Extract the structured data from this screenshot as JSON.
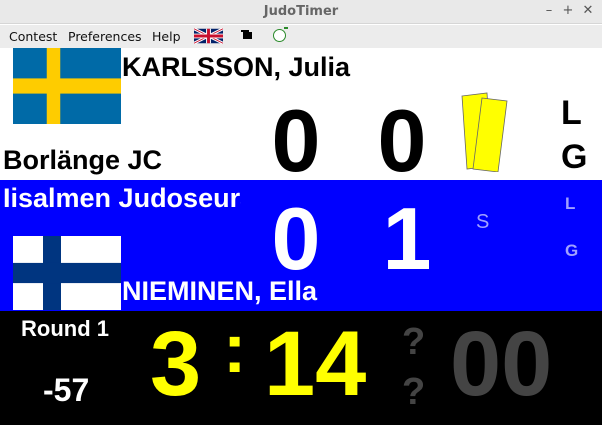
{
  "window": {
    "title": "JudoTimer",
    "min_glyph": "–",
    "max_glyph": "+",
    "close_glyph": "✕"
  },
  "menu": {
    "items": [
      "Contest",
      "Preferences",
      "Help"
    ],
    "icons": [
      "uk-flag-icon",
      "black-rectangle-icon",
      "green-circle-icon"
    ]
  },
  "white_competitor": {
    "name": "KARLSSON, Julia",
    "club": "Borlänge JC",
    "country_flag": "sweden-flag-icon",
    "score_left": "0",
    "score_right": "0",
    "penalty_top": "L",
    "penalty_bottom": "G",
    "cards": "yellow",
    "colors": {
      "background": "#ffffff",
      "text": "#000000",
      "card": "#ffff00"
    }
  },
  "blue_competitor": {
    "name": "NIEMINEN, Ella",
    "club": "Iisalmen Judoseura",
    "country_flag": "finland-flag-icon",
    "score_left": "0",
    "score_right": "1",
    "indicator": "S",
    "penalty_top": "L",
    "penalty_bottom": "G",
    "colors": {
      "background": "#0000ff",
      "text": "#ffffff",
      "dim": "#a0a0ff"
    }
  },
  "clock": {
    "round": "Round 1",
    "weight_class": "-57",
    "minutes": "3",
    "separator": ":",
    "seconds": "14",
    "osaekomi_mark": "?",
    "osaekomi_time": "00",
    "colors": {
      "time": "#ffff00",
      "dim": "#444444"
    }
  }
}
